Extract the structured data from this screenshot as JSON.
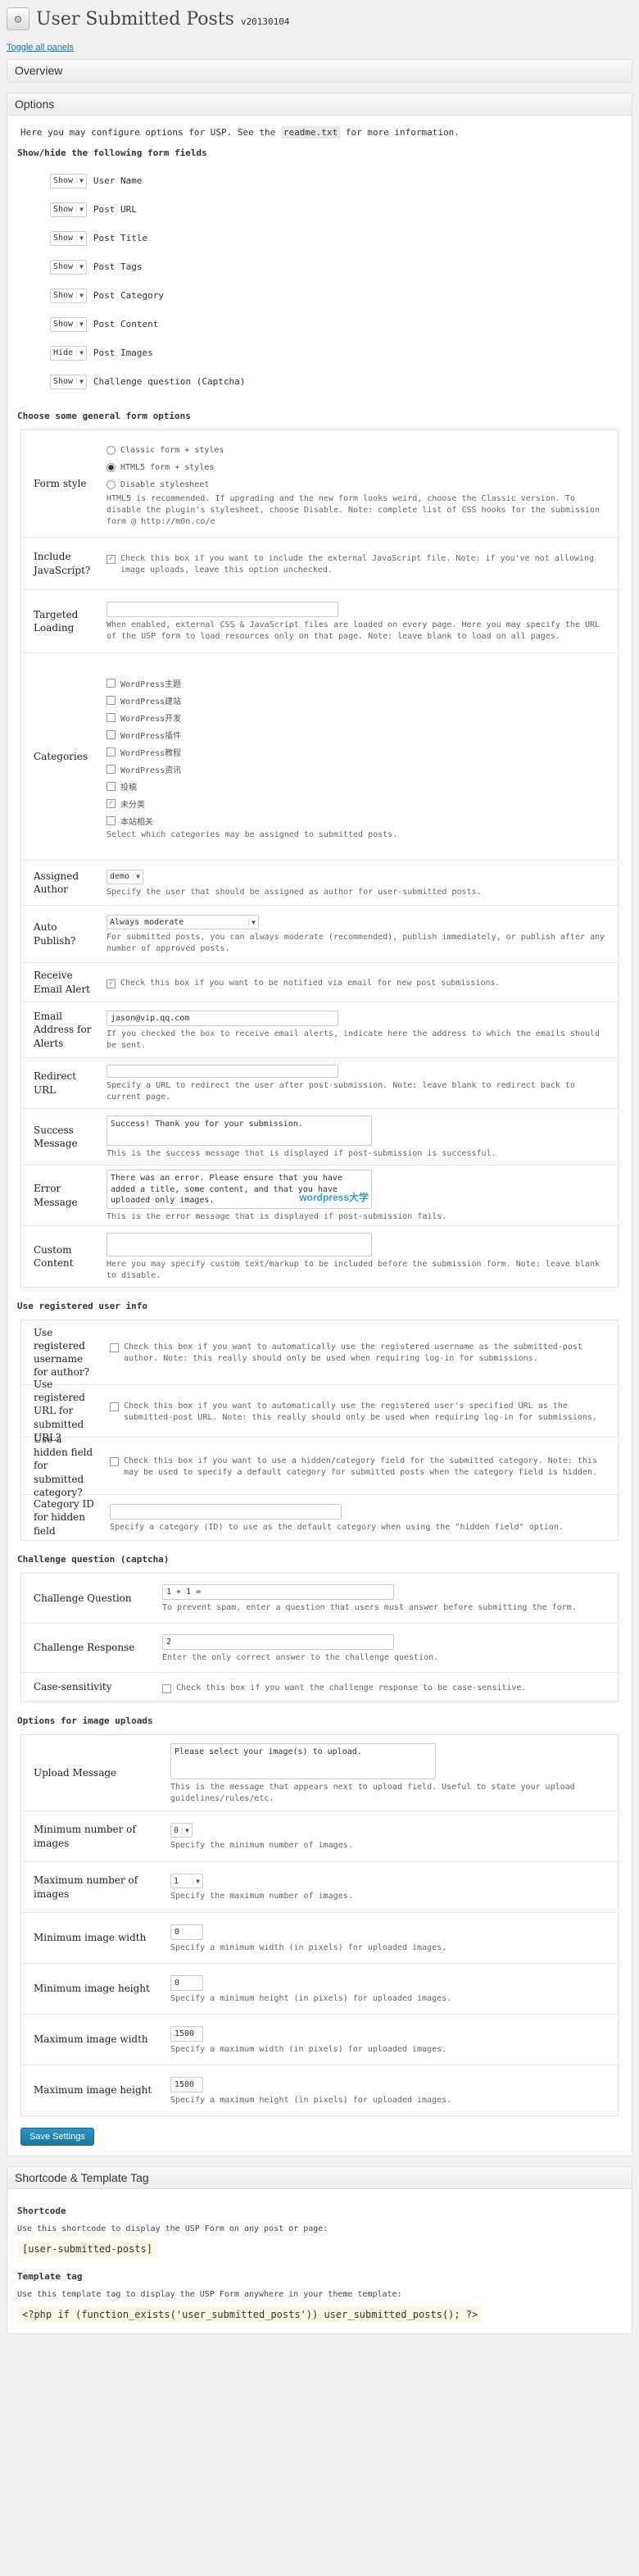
{
  "header": {
    "title": "User Submitted Posts",
    "version": "v20130104",
    "toggle_link": "Toggle all panels"
  },
  "overview": {
    "title": "Overview"
  },
  "options": {
    "title": "Options",
    "intro_before": "Here you may configure options for USP. See the ",
    "intro_code": "readme.txt",
    "intro_after": " for more information.",
    "show_hide_title": "Show/hide the following form fields",
    "fields": [
      {
        "state": "Show",
        "label": "User Name"
      },
      {
        "state": "Show",
        "label": "Post URL"
      },
      {
        "state": "Show",
        "label": "Post Title"
      },
      {
        "state": "Show",
        "label": "Post Tags"
      },
      {
        "state": "Show",
        "label": "Post Category"
      },
      {
        "state": "Show",
        "label": "Post Content"
      },
      {
        "state": "Hide",
        "label": "Post Images"
      },
      {
        "state": "Show",
        "label": "Challenge question (Captcha)"
      }
    ],
    "general_title": "Choose some general form options",
    "form_style": {
      "label": "Form style",
      "opt1": "Classic form + styles",
      "opt2": "HTML5 form + styles",
      "opt3": "Disable stylesheet",
      "desc": "HTML5 is recommended. If upgrading and the new form looks weird, choose the Classic version. To disable the plugin's stylesheet, choose Disable. Note: complete list of CSS hooks for the submission form @ http://m0n.co/e"
    },
    "include_js": {
      "label": "Include JavaScript?",
      "desc": "Check this box if you want to include the external JavaScript file. Note: if you've not allowing image uploads, leave this option unchecked."
    },
    "targeted_loading": {
      "label": "Targeted Loading",
      "value": "",
      "desc": "When enabled, external CSS & JavaScript files are loaded on every page. Here you may specify the URL of the USP form to load resources only on that page. Note: leave blank to load on all pages."
    },
    "categories": {
      "label": "Categories",
      "items": [
        "WordPress主题",
        "WordPress建站",
        "WordPress开发",
        "WordPress插件",
        "WordPress教程",
        "WordPress资讯",
        "投稿",
        "未分类",
        "本站相关"
      ],
      "checked_index": 7,
      "desc": "Select which categories may be assigned to submitted posts."
    },
    "assigned_author": {
      "label": "Assigned Author",
      "value": "demo",
      "desc": "Specify the user that should be assigned as author for user-submitted posts."
    },
    "auto_publish": {
      "label": "Auto Publish?",
      "value": "Always moderate",
      "desc": "For submitted posts, you can always moderate (recommended), publish immediately, or publish after any number of approved posts."
    },
    "receive_alert": {
      "label": "Receive Email Alert",
      "desc": "Check this box if you want to be notified via email for new post submissions."
    },
    "email_address": {
      "label": "Email Address for Alerts",
      "value": "jason@vip.qq.com",
      "desc": "If you checked the box to receive email alerts, indicate here the address to which the emails should be sent."
    },
    "redirect_url": {
      "label": "Redirect URL",
      "value": "",
      "desc": "Specify a URL to redirect the user after post-submission. Note: leave blank to redirect back to current page."
    },
    "success_message": {
      "label": "Success Message",
      "value": "Success! Thank you for your submission.",
      "desc": "This is the success message that is displayed if post-submission is successful."
    },
    "error_message": {
      "label": "Error Message",
      "value": "There was an error. Please ensure that you have added a title, some content, and that you have uploaded only images.",
      "watermark": "wordpress大学",
      "desc": "This is the error message that is displayed if post-submission fails."
    },
    "custom_content": {
      "label": "Custom Content",
      "value": "",
      "desc": "Here you may specify custom text/markup to be included before the submission form. Note: leave blank to disable."
    },
    "registered_title": "Use registered user info",
    "reg_username": {
      "label": "Use registered username for author?",
      "desc": "Check this box if you want to automatically use the registered username as the submitted-post author. Note: this really should only be used when requiring log-in for submissions."
    },
    "reg_url": {
      "label": "Use registered URL for submitted URL?",
      "desc": "Check this box if you want to automatically use the registered user's specified URL as the submitted-post URL. Note: this really should only be used when requiring log-in for submissions."
    },
    "hidden_field": {
      "label": "Use a hidden field for submitted category?",
      "desc": "Check this box if you want to use a hidden/category field for the submitted category. Note: this may be used to specify a default category for submitted posts when the category field is hidden."
    },
    "category_id": {
      "label": "Category ID for hidden field",
      "value": "",
      "desc": "Specify a category (ID) to use as the default category when using the \"hidden field\" option."
    },
    "challenge_title": "Challenge question (captcha)",
    "challenge_question": {
      "label": "Challenge Question",
      "value": "1 + 1 =",
      "desc": "To prevent spam, enter a question that users must answer before submitting the form."
    },
    "challenge_response": {
      "label": "Challenge Response",
      "value": "2",
      "desc": "Enter the only correct answer to the challenge question."
    },
    "case_sensitivity": {
      "label": "Case-sensitivity",
      "desc": "Check this box if you want the challenge response to be case-sensitive."
    },
    "uploads_title": "Options for image uploads",
    "upload_message": {
      "label": "Upload Message",
      "value": "Please select your image(s) to upload.",
      "desc": "This is the message that appears next to upload field. Useful to state your upload guidelines/rules/etc."
    },
    "min_images": {
      "label": "Minimum number of images",
      "value": "0",
      "desc": "Specify the minimum number of images."
    },
    "max_images": {
      "label": "Maximum number of images",
      "value": "1",
      "desc": "Specify the maximum number of images."
    },
    "min_width": {
      "label": "Minimum image width",
      "value": "0",
      "desc": "Specify a minimum width (in pixels) for uploaded images."
    },
    "min_height": {
      "label": "Minimum image height",
      "value": "0",
      "desc": "Specify a minimum height (in pixels) for uploaded images."
    },
    "max_width": {
      "label": "Maximum image width",
      "value": "1500",
      "desc": "Specify a maximum width (in pixels) for uploaded images."
    },
    "max_height": {
      "label": "Maximum image height",
      "value": "1500",
      "desc": "Specify a maximum height (in pixels) for uploaded images."
    },
    "save_label": "Save Settings"
  },
  "shortcode_panel": {
    "title": "Shortcode & Template Tag",
    "shortcode_title": "Shortcode",
    "shortcode_desc": "Use this shortcode to display the USP Form on any post or page:",
    "shortcode_code": "[user-submitted-posts]",
    "template_title": "Template tag",
    "template_desc": "Use this template tag to display the USP Form anywhere in your theme template:",
    "template_code": "<?php if (function_exists('user_submitted_posts')) user_submitted_posts(); ?>"
  },
  "colors": {
    "link": "#21759b",
    "button": "#21759b",
    "check": "#22aa22"
  }
}
